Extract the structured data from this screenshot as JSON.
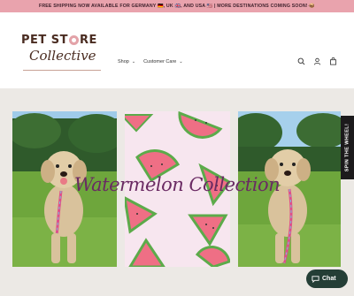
{
  "announcement": {
    "text": "FREE SHIPPING NOW AVAILABLE FOR GERMANY 🇩🇪, UK 🇬🇧, AND USA 🇺🇸 | MORE DESTINATIONS COMING SOON! 📦",
    "arrow": "→"
  },
  "logo": {
    "line1_left": "PET ST",
    "line1_right": "RE",
    "line2": "Collective"
  },
  "nav": {
    "items": [
      {
        "label": "Shop",
        "caret": "⌄"
      },
      {
        "label": "Customer Care",
        "caret": "⌄"
      }
    ]
  },
  "hero": {
    "title": "Watermelon Collection"
  },
  "wheel": {
    "label": "SPIN THE WHEEL!"
  },
  "chat": {
    "label": "Chat"
  },
  "colors": {
    "announce_bg": "#e9a3ad",
    "hero_bg": "#ece9e5",
    "title": "#6a2a63",
    "chat_bg": "#243e36"
  }
}
